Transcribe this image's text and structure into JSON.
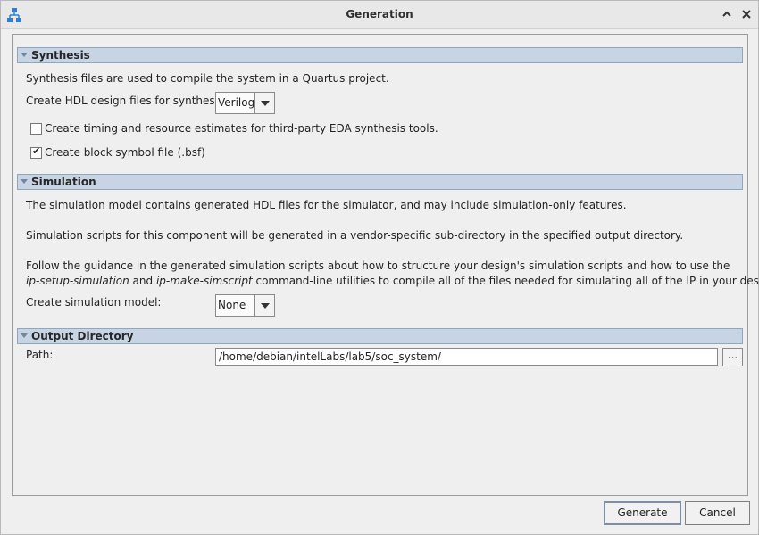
{
  "window": {
    "title": "Generation"
  },
  "synthesis": {
    "header": "Synthesis",
    "description": "Synthesis files are used to compile the system in a Quartus project.",
    "hdl_label": "Create HDL design files for synthesis:",
    "hdl_value": "Verilog",
    "timing_label": "Create timing and resource estimates for third-party EDA synthesis tools.",
    "timing_checked": false,
    "bsf_label": "Create block symbol file (.bsf)",
    "bsf_checked": true
  },
  "simulation": {
    "header": "Simulation",
    "para1": "The simulation model contains generated HDL files for the simulator, and may include simulation-only features.",
    "para2": "Simulation scripts for this component will be generated in a vendor-specific sub-directory in the specified output directory.",
    "para3_line1": "Follow the guidance in the generated simulation scripts about how to structure your design's simulation scripts and how to use the",
    "para3_tool1": "ip-setup-simulation",
    "para3_and": " and ",
    "para3_tool2": "ip-make-simscript",
    "para3_rest": " command-line utilities to compile all of the files needed for simulating all of the IP in your design.",
    "model_label": "Create simulation model:",
    "model_value": "None"
  },
  "output": {
    "header": "Output Directory",
    "path_label": "Path:",
    "path_value": "/home/debian/intelLabs/lab5/soc_system/",
    "browse_label": "..."
  },
  "buttons": {
    "generate": "Generate",
    "cancel": "Cancel"
  },
  "icons": {
    "app": "hierarchy-icon",
    "minimize": "chevron-up-icon",
    "close": "close-icon"
  }
}
